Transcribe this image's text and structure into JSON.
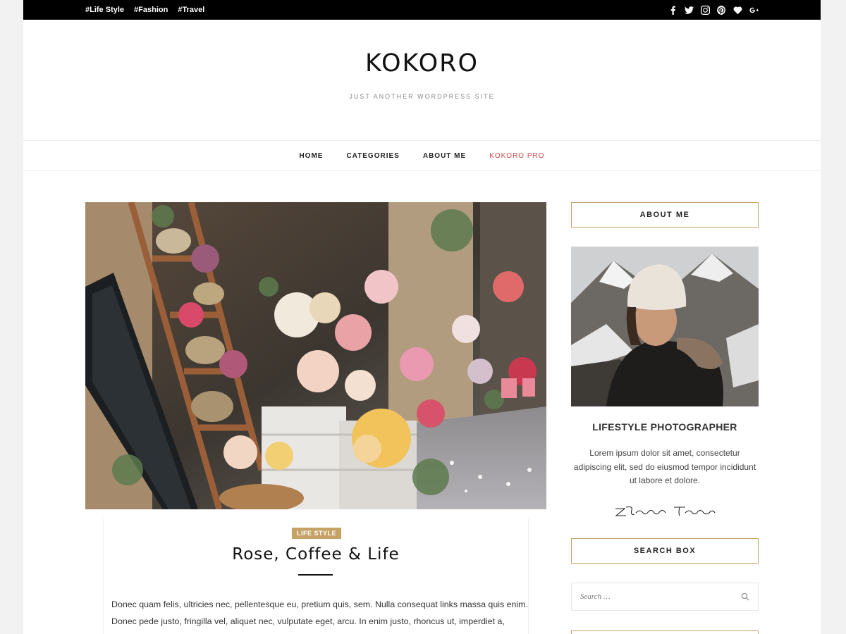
{
  "topbar": {
    "tags": [
      "#Life Style",
      "#Fashion",
      "#Travel"
    ],
    "social_icons": [
      "facebook-icon",
      "twitter-icon",
      "instagram-icon",
      "pinterest-icon",
      "heart-icon",
      "google-plus-icon"
    ]
  },
  "header": {
    "title": "KOKORO",
    "description": "JUST ANOTHER WORDPRESS SITE"
  },
  "nav": {
    "items": [
      "HOME",
      "CATEGORIES",
      "ABOUT ME",
      "KOKORO PRO"
    ]
  },
  "post": {
    "category": "LIFE STYLE",
    "title": "Rose, Coffee & Life",
    "excerpt": "Donec quam felis, ultricies nec, pellentesque eu, pretium quis, sem. Nulla consequat links massa quis enim. Donec pede justo, fringilla vel, aliquet nec, vulputate eget, arcu. In enim justo, rhoncus ut, imperdiet a, venenatis vitae, justo. Nullam dictum felis eu pede mollis pretium. Integer tincidunt. Cras dapibus."
  },
  "sidebar": {
    "about_title": "ABOUT ME",
    "about_name": "LIFESTYLE PHOTOGRAPHER",
    "about_text": "Lorem ipsum dolor sit amet, consectetur adipiscing elit, sed do eiusmod tempor incididunt ut labore et dolore.",
    "signature": "ZThemes Team",
    "search_title": "SEARCH BOX",
    "search_placeholder": "Search …"
  },
  "colors": {
    "accent": "#c6a267",
    "pro_link": "#d24b4b",
    "topbar": "#000000"
  }
}
